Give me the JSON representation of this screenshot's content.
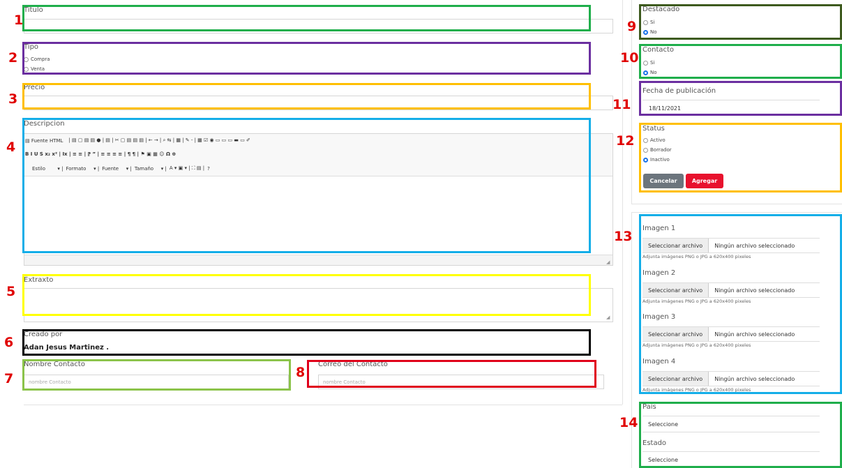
{
  "form": {
    "titulo": {
      "label": "Titulo",
      "value": ""
    },
    "tipo": {
      "label": "Tipo",
      "options": [
        "Compra",
        "Venta"
      ],
      "selected": ""
    },
    "precio": {
      "label": "Precio",
      "value": ""
    },
    "descripcion": {
      "label": "Descripcion",
      "toolbar": {
        "fuente_html": "Fuente HTML",
        "estilo": "Estilo",
        "formato": "Formato",
        "fuente": "Fuente",
        "tamano": "Tamaño",
        "row2_glyphs": "B  I  U  S  x₂  x²  |  Ix  |  ≡  ≡  |  ⁋  ”  |  ≡  ≡  ≡  ≡  |  ¶  ¶  |  ⚑  ▣  ▦  ☺  Ω  ⊕",
        "help": "?"
      },
      "value": ""
    },
    "extracto": {
      "label": "Extraxto",
      "value": ""
    },
    "creado_por": {
      "label": "Creado por",
      "value": "Adan Jesus Martinez ."
    },
    "nombre_contacto": {
      "label": "Nombre Contacto",
      "placeholder": "nombre Contacto"
    },
    "correo_contacto": {
      "label": "Correo del Contacto",
      "placeholder": "nombre Contacto"
    }
  },
  "sidebar": {
    "destacado": {
      "label": "Destacado",
      "options": [
        "Si",
        "No"
      ],
      "selected": "No"
    },
    "contacto": {
      "label": "Contacto",
      "options": [
        "Si",
        "No"
      ],
      "selected": "No"
    },
    "fecha": {
      "label": "Fecha de publicación",
      "value": "18/11/2021"
    },
    "status": {
      "label": "Status",
      "options": [
        "Activo",
        "Borrador",
        "Inactivo"
      ],
      "selected": "Inactivo"
    },
    "buttons": {
      "cancel": "Cancelar",
      "add": "Agregar"
    },
    "images": [
      {
        "label": "Imagen 1",
        "button": "Seleccionar archivo",
        "file": "Ningún archivo seleccionado",
        "hint": "Adjunta imágenes PNG o JPG a 620x400 pixeles"
      },
      {
        "label": "Imagen 2",
        "button": "Seleccionar archivo",
        "file": "Ningún archivo seleccionado",
        "hint": "Adjunta imágenes PNG o JPG a 620x400 pixeles"
      },
      {
        "label": "Imagen 3",
        "button": "Seleccionar archivo",
        "file": "Ningún archivo seleccionado",
        "hint": "Adjunta imágenes PNG o JPG a 620x400 pixeles"
      },
      {
        "label": "Imagen 4",
        "button": "Seleccionar archivo",
        "file": "Ningún archivo seleccionado",
        "hint": "Adjunta imágenes PNG o JPG a 620x400 pixeles"
      }
    ],
    "pais": {
      "label": "Pais",
      "value": "Seleccione"
    },
    "estado": {
      "label": "Estado",
      "value": "Seleccione"
    }
  },
  "annotations": {
    "numbers": [
      "1",
      "2",
      "3",
      "4",
      "5",
      "6",
      "7",
      "8",
      "9",
      "10",
      "11",
      "12",
      "13",
      "14"
    ],
    "colors": {
      "green": "#1fae4b",
      "purple": "#6b2fa0",
      "orange": "#ffbf00",
      "blue": "#14aee8",
      "yellow": "#ffff00",
      "black": "#000000",
      "lightgreen": "#8bc34a",
      "red": "#e0001b",
      "darkgreen": "#3d5a1e",
      "num": "#e00000"
    }
  }
}
